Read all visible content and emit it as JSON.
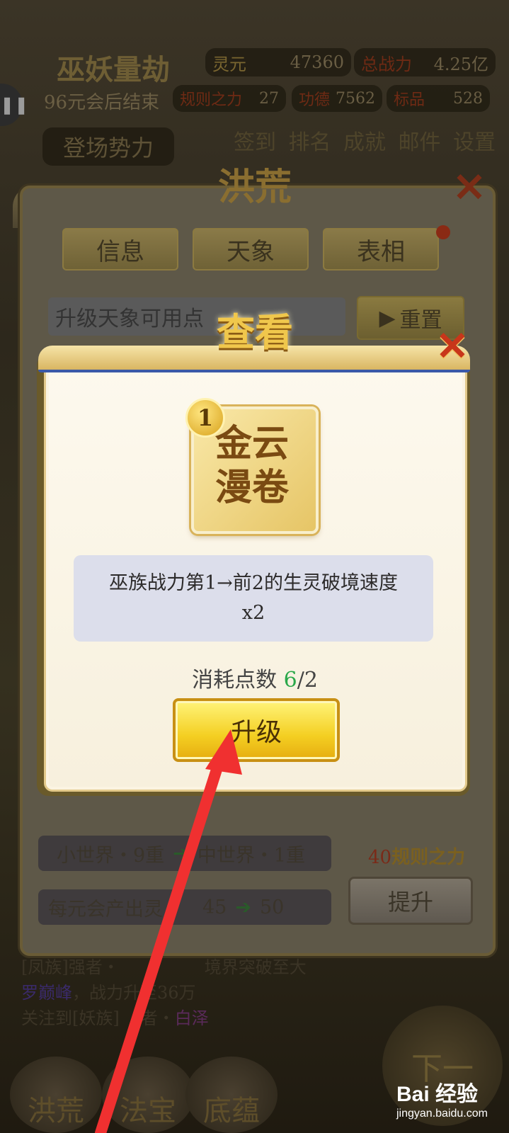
{
  "header": {
    "event_name": "巫妖量劫",
    "end_text": "96元会后结束",
    "stats": {
      "lingyuan_label": "灵元",
      "lingyuan_value": "47360",
      "zongzhanli_label": "总战力",
      "zongzhanli_value": "4.25亿",
      "guize_label": "规则之力",
      "guize_value": "27",
      "gongde_label": "功德",
      "gongde_value": "7562",
      "extra_label": "标品",
      "extra_value": "528"
    },
    "faction_button": "登场势力",
    "menu": [
      "签到",
      "排名",
      "成就",
      "邮件",
      "设置"
    ]
  },
  "outer_dialog": {
    "title": "洪荒",
    "tabs": [
      "信息",
      "天象",
      "表相"
    ],
    "points_text": "升级天象可用点",
    "reset_label": "重置",
    "row1": {
      "from": "小世界・9重",
      "to": "中世界・1重"
    },
    "row2": {
      "label": "每元会产出灵",
      "from": "45",
      "to": "50"
    },
    "cost_amount": "40",
    "cost_label": "规则之力",
    "raise_label": "提升"
  },
  "inner_dialog": {
    "title": "查看",
    "card_level": "1",
    "card_line1": "金云",
    "card_line2": "漫卷",
    "description": "巫族战力第1→前2的生灵破境速度x2",
    "cost_prefix": "消耗点数",
    "cost_have": "6",
    "cost_sep": "/",
    "cost_need": "2",
    "upgrade_label": "升级"
  },
  "log": {
    "line1": "[凤族]强者・",
    "line1b": "境界突破至大",
    "line2_name": "罗巅峰",
    "line2_rest": "，战力升至36万",
    "line3": "关注到[妖族]",
    "line3b": "者・",
    "line3_name": "白泽"
  },
  "bottom_nav": [
    "洪荒",
    "法宝",
    "底蕴"
  ],
  "next_label": "下一",
  "watermark": {
    "brand": "Bai 经验",
    "url": "jingyan.baidu.com"
  },
  "colors": {
    "arrow": "#f03030",
    "upgrade_button": "#f4cf22",
    "green_value": "#2aa84a"
  }
}
